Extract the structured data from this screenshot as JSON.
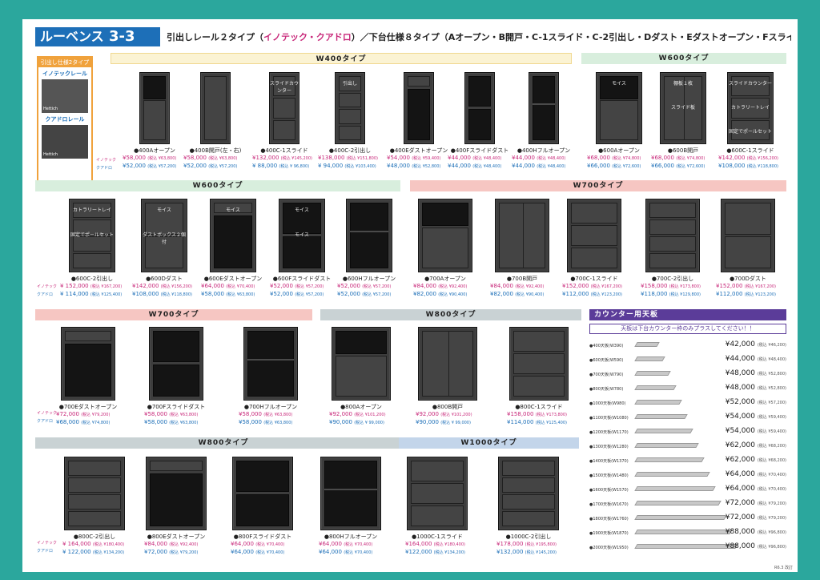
{
  "header": {
    "brand": "ルーベンス",
    "section": "3-3",
    "title_a": "引出しレール２タイプ（",
    "title_rails": "イノテック・クアドロ",
    "title_b": "）／下台仕様８タイプ（Aオープン・B開戸・C-1スライド・C-2引出し・Dダスト・Eダストオープン・Fスライドダスト・Hフルオープン）"
  },
  "rail_box": {
    "title": "引出し仕様2タイプ",
    "rail1": "イノテックレール",
    "rail2": "クアドロレール",
    "logo": "Hettich"
  },
  "row_tags": {
    "innotech": "イノテック",
    "quadro": "クアドロ"
  },
  "sections": {
    "w400a": "W400タイプ",
    "w600a": "W600タイプ",
    "w600b": "W600タイプ",
    "w700a": "W700タイプ",
    "w700b": "W700タイプ",
    "w800a": "W800タイプ",
    "w800b": "W800タイプ",
    "w1000": "W1000タイプ",
    "counter": "カウンター用天板"
  },
  "items": [
    {
      "name": "●400Aオープン",
      "p1": "¥58,000",
      "t1": "(税込 ¥63,800)",
      "p2": "¥52,000",
      "t2": "(税込 ¥57,200)"
    },
    {
      "name": "●400B開戸(左・右)",
      "p1": "¥58,000",
      "t1": "(税込 ¥63,800)",
      "p2": "¥52,000",
      "t2": "(税込 ¥57,200)"
    },
    {
      "name": "●400C-1スライド",
      "p1": "¥132,000",
      "t1": "(税込 ¥145,200)",
      "p2": "¥ 88,000",
      "t2": "(税込 ¥ 96,800)"
    },
    {
      "name": "●400C-2引出し",
      "p1": "¥138,000",
      "t1": "(税込 ¥151,800)",
      "p2": "¥ 94,000",
      "t2": "(税込 ¥103,400)"
    },
    {
      "name": "●400Eダストオープン",
      "p1": "¥54,000",
      "t1": "(税込 ¥59,400)",
      "p2": "¥48,000",
      "t2": "(税込 ¥52,800)"
    },
    {
      "name": "●400Fスライドダスト",
      "p1": "¥44,000",
      "t1": "(税込 ¥48,400)",
      "p2": "¥44,000",
      "t2": "(税込 ¥48,400)"
    },
    {
      "name": "●400Hフルオープン",
      "p1": "¥44,000",
      "t1": "(税込 ¥48,400)",
      "p2": "¥44,000",
      "t2": "(税込 ¥48,400)"
    },
    {
      "name": "●600Aオープン",
      "p1": "¥68,000",
      "t1": "(税込 ¥74,800)",
      "p2": "¥66,000",
      "t2": "(税込 ¥72,600)"
    },
    {
      "name": "●600B開戸",
      "p1": "¥68,000",
      "t1": "(税込 ¥74,800)",
      "p2": "¥66,000",
      "t2": "(税込 ¥72,600)"
    },
    {
      "name": "●600C-1スライド",
      "p1": "¥142,000",
      "t1": "(税込 ¥156,200)",
      "p2": "¥108,000",
      "t2": "(税込 ¥118,800)"
    },
    {
      "name": "●600C-2引出し",
      "p1": "¥ 152,000",
      "t1": "(税込 ¥167,200)",
      "p2": "¥ 114,000",
      "t2": "(税込 ¥125,400)"
    },
    {
      "name": "●600Dダスト",
      "p1": "¥142,000",
      "t1": "(税込 ¥156,200)",
      "p2": "¥108,000",
      "t2": "(税込 ¥118,800)"
    },
    {
      "name": "●600Eダストオープン",
      "p1": "¥64,000",
      "t1": "(税込 ¥70,400)",
      "p2": "¥58,000",
      "t2": "(税込 ¥63,800)"
    },
    {
      "name": "●600Fスライドダスト",
      "p1": "¥52,000",
      "t1": "(税込 ¥57,200)",
      "p2": "¥52,000",
      "t2": "(税込 ¥57,200)"
    },
    {
      "name": "●600Hフルオープン",
      "p1": "¥52,000",
      "t1": "(税込 ¥57,200)",
      "p2": "¥52,000",
      "t2": "(税込 ¥57,200)"
    },
    {
      "name": "●700Aオープン",
      "p1": "¥84,000",
      "t1": "(税込 ¥92,400)",
      "p2": "¥82,000",
      "t2": "(税込 ¥90,400)"
    },
    {
      "name": "●700B開戸",
      "p1": "¥84,000",
      "t1": "(税込 ¥92,400)",
      "p2": "¥82,000",
      "t2": "(税込 ¥90,400)"
    },
    {
      "name": "●700C-1スライド",
      "p1": "¥152,000",
      "t1": "(税込 ¥167,200)",
      "p2": "¥112,000",
      "t2": "(税込 ¥123,200)"
    },
    {
      "name": "●700C-2引出し",
      "p1": "¥158,000",
      "t1": "(税込 ¥173,800)",
      "p2": "¥118,000",
      "t2": "(税込 ¥129,800)"
    },
    {
      "name": "●700Dダスト",
      "p1": "¥152,000",
      "t1": "(税込 ¥167,200)",
      "p2": "¥112,000",
      "t2": "(税込 ¥123,200)"
    },
    {
      "name": "●700Eダストオープン",
      "p1": "¥72,000",
      "t1": "(税込 ¥79,200)",
      "p2": "¥68,000",
      "t2": "(税込 ¥74,800)"
    },
    {
      "name": "●700Fスライドダスト",
      "p1": "¥58,000",
      "t1": "(税込 ¥63,800)",
      "p2": "¥58,000",
      "t2": "(税込 ¥63,800)"
    },
    {
      "name": "●700Hフルオープン",
      "p1": "¥58,000",
      "t1": "(税込 ¥63,800)",
      "p2": "¥58,000",
      "t2": "(税込 ¥63,800)"
    },
    {
      "name": "●800Aオープン",
      "p1": "¥92,000",
      "t1": "(税込 ¥101,200)",
      "p2": "¥90,000",
      "t2": "(税込 ¥ 99,000)"
    },
    {
      "name": "●800B開戸",
      "p1": "¥92,000",
      "t1": "(税込 ¥101,200)",
      "p2": "¥90,000",
      "t2": "(税込 ¥ 99,000)"
    },
    {
      "name": "●800C-1スライド",
      "p1": "¥158,000",
      "t1": "(税込 ¥173,800)",
      "p2": "¥114,000",
      "t2": "(税込 ¥125,400)"
    },
    {
      "name": "●800C-2引出し",
      "p1": "¥ 164,000",
      "t1": "(税込 ¥180,400)",
      "p2": "¥ 122,000",
      "t2": "(税込 ¥134,200)"
    },
    {
      "name": "●800Eダストオープン",
      "p1": "¥84,000",
      "t1": "(税込 ¥92,400)",
      "p2": "¥72,000",
      "t2": "(税込 ¥79,200)"
    },
    {
      "name": "●800Fスライドダスト",
      "p1": "¥64,000",
      "t1": "(税込 ¥70,400)",
      "p2": "¥64,000",
      "t2": "(税込 ¥70,400)"
    },
    {
      "name": "●800Hフルオープン",
      "p1": "¥64,000",
      "t1": "(税込 ¥70,400)",
      "p2": "¥64,000",
      "t2": "(税込 ¥70,400)"
    },
    {
      "name": "●1000C-1スライド",
      "p1": "¥164,000",
      "t1": "(税込 ¥180,400)",
      "p2": "¥122,000",
      "t2": "(税込 ¥134,200)"
    },
    {
      "name": "●1000C-2引出し",
      "p1": "¥178,000",
      "t1": "(税込 ¥195,800)",
      "p2": "¥132,000",
      "t2": "(税込 ¥145,200)"
    }
  ],
  "cab_labels": {
    "slide_counter": "スライドカウンター",
    "drawer": "引出し",
    "moisu": "モイス",
    "shelf1": "棚板１枚",
    "slide_dust": "スライド板",
    "cutlery": "カトラリートレイ",
    "pole": "固定でポールセット",
    "dustbox": "ダストボックス２個付"
  },
  "counter": {
    "notice": "天板は下台カウンター枠のみプラスしてください！！",
    "rows": [
      {
        "name": "●400天板(W390)",
        "price": "¥42,000",
        "tax": "(税込 ¥46,200)"
      },
      {
        "name": "●600天板(W590)",
        "price": "¥44,000",
        "tax": "(税込 ¥48,400)"
      },
      {
        "name": "●700天板(W790)",
        "price": "¥48,000",
        "tax": "(税込 ¥52,800)"
      },
      {
        "name": "●800天板(W780)",
        "price": "¥48,000",
        "tax": "(税込 ¥52,800)"
      },
      {
        "name": "●1000天板(W980)",
        "price": "¥52,000",
        "tax": "(税込 ¥57,200)"
      },
      {
        "name": "●1100天板(W1080)",
        "price": "¥54,000",
        "tax": "(税込 ¥59,400)"
      },
      {
        "name": "●1200天板(W1170)",
        "price": "¥54,000",
        "tax": "(税込 ¥59,400)"
      },
      {
        "name": "●1300天板(W1280)",
        "price": "¥62,000",
        "tax": "(税込 ¥68,200)"
      },
      {
        "name": "●1400天板(W1370)",
        "price": "¥62,000",
        "tax": "(税込 ¥68,200)"
      },
      {
        "name": "●1500天板(W1480)",
        "price": "¥64,000",
        "tax": "(税込 ¥70,400)"
      },
      {
        "name": "●1600天板(W1570)",
        "price": "¥64,000",
        "tax": "(税込 ¥70,400)"
      },
      {
        "name": "●1700天板(W1670)",
        "price": "¥72,000",
        "tax": "(税込 ¥79,200)"
      },
      {
        "name": "●1800天板(W1760)",
        "price": "¥72,000",
        "tax": "(税込 ¥79,200)"
      },
      {
        "name": "●1900天板(W1870)",
        "price": "¥88,000",
        "tax": "(税込 ¥96,800)"
      },
      {
        "name": "●2000天板(W1950)",
        "price": "¥88,000",
        "tax": "(税込 ¥96,800)"
      }
    ]
  },
  "page_no": "R6.3  改訂"
}
